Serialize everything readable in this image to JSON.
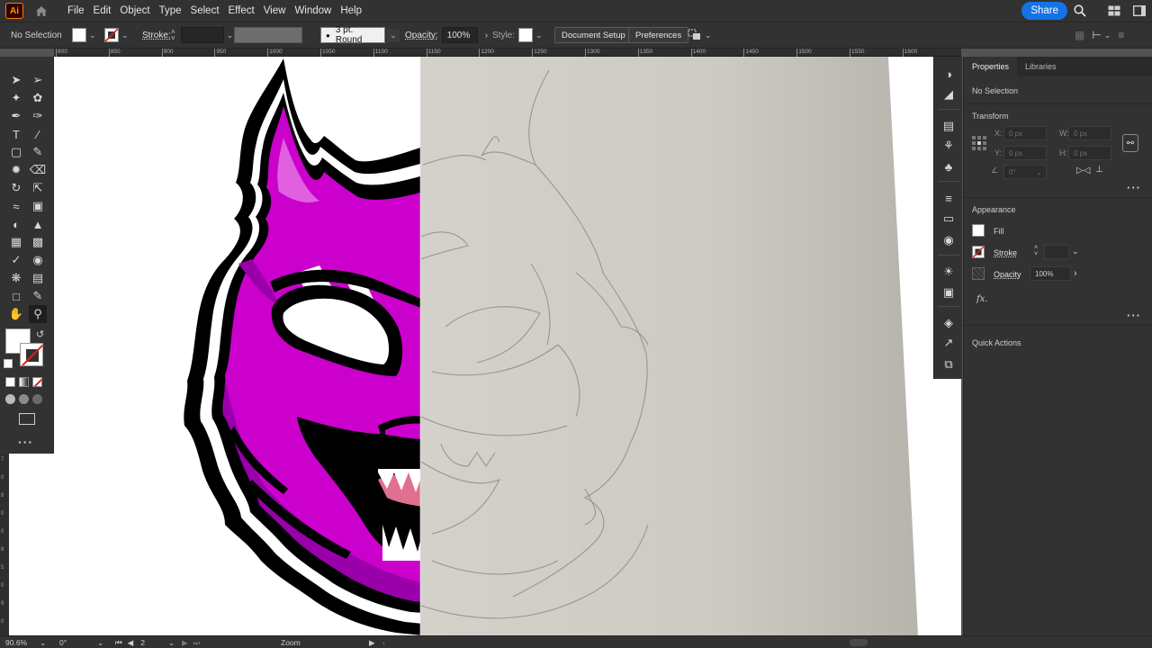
{
  "menubar": {
    "app_logo": "Ai",
    "items": [
      "File",
      "Edit",
      "Object",
      "Type",
      "Select",
      "Effect",
      "View",
      "Window",
      "Help"
    ],
    "share_label": "Share",
    "icons": [
      "home-icon",
      "search-icon",
      "arrange-documents-icon",
      "panel-layout-icon"
    ]
  },
  "controlbar": {
    "selection_label": "No Selection",
    "stroke_label": "Stroke:",
    "brush_label": "3 pt. Round",
    "opacity_label": "Opacity:",
    "opacity_value": "100%",
    "style_label": "Style:",
    "document_setup": "Document Setup",
    "preferences": "Preferences"
  },
  "ruler": {
    "top_labels": [
      "800",
      "850",
      "900",
      "950",
      "1000",
      "1050",
      "1100",
      "1150",
      "1200",
      "1250",
      "1300",
      "1350",
      "1400",
      "1450",
      "1500",
      "1550",
      "1600"
    ],
    "left_labels": [
      "7",
      "0",
      "8",
      "0",
      "0",
      "8",
      "5",
      "0",
      "9",
      "0"
    ]
  },
  "tools": {
    "items": [
      "selection-tool",
      "direct-selection-tool",
      "magic-wand-tool",
      "lasso-tool",
      "pen-tool",
      "curvature-tool",
      "type-tool",
      "line-segment-tool",
      "rectangle-tool",
      "paintbrush-tool",
      "shaper-tool",
      "eraser-tool",
      "rotate-tool",
      "scale-tool",
      "warp-tool",
      "free-transform-tool",
      "shape-builder-tool",
      "perspective-grid-tool",
      "mesh-tool",
      "gradient-tool",
      "eyedropper-tool",
      "blend-tool",
      "symbol-sprayer-tool",
      "column-graph-tool",
      "artboard-tool",
      "slice-tool",
      "hand-tool",
      "zoom-tool"
    ],
    "active": "zoom-tool"
  },
  "dock": {
    "icons": [
      "color-guide-icon",
      "color-icon",
      "swatches-icon",
      "brushes-icon",
      "symbols-icon",
      "stroke-icon",
      "gradient-icon",
      "transparency-icon",
      "appearance-icon",
      "graphic-styles-icon",
      "layers-icon",
      "asset-export-icon",
      "artboards-icon"
    ]
  },
  "properties": {
    "tabs": [
      "Properties",
      "Libraries"
    ],
    "active_tab": "Properties",
    "no_selection": "No Selection",
    "transform_title": "Transform",
    "x_label": "X:",
    "x_value": "0 px",
    "y_label": "Y:",
    "y_value": "0 px",
    "w_label": "W:",
    "w_value": "0 px",
    "h_label": "H:",
    "h_value": "0 px",
    "angle_value": "0°",
    "appearance_title": "Appearance",
    "fill_label": "Fill",
    "stroke_label": "Stroke",
    "opacity_label": "Opacity",
    "opacity_value": "100%",
    "fx_label": "fx.",
    "quick_actions_title": "Quick Actions"
  },
  "statusbar": {
    "zoom": "90.6%",
    "rotation": "0°",
    "artboard_number": "2",
    "tool_name": "Zoom"
  },
  "colors": {
    "accent": "#1473e6",
    "mascot_magenta": "#cc00cc",
    "mascot_dark_purple": "#9900aa",
    "sketch_paper": "#d2cfc9"
  }
}
